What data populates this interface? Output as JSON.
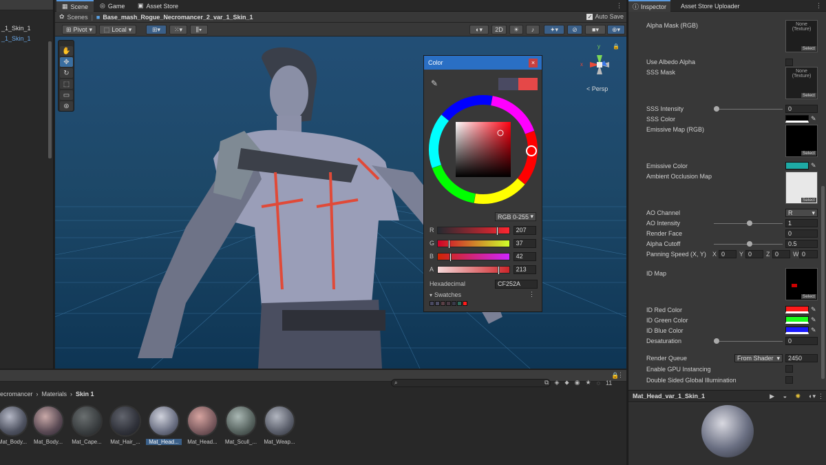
{
  "hierarchy": {
    "items": [
      "_1_Skin_1",
      "_1_Skin_1"
    ]
  },
  "tabs": {
    "scene": "Scene",
    "game": "Game",
    "store": "Asset Store"
  },
  "breadcrumb": {
    "scenes": "Scenes",
    "object": "Base_mash_Rogue_Necromancer_2_var_1_Skin_1",
    "autosave": "Auto Save"
  },
  "toolbar": {
    "pivot": "Pivot",
    "local": "Local",
    "twod": "2D",
    "persp": "< Persp"
  },
  "colorpicker": {
    "title": "Color",
    "mode": "RGB 0-255",
    "channels": [
      {
        "label": "R",
        "value": "207"
      },
      {
        "label": "G",
        "value": "37"
      },
      {
        "label": "B",
        "value": "42"
      },
      {
        "label": "A",
        "value": "213"
      }
    ],
    "hex_label": "Hexadecimal",
    "hex_value": "CF252A",
    "swatches_label": "Swatches",
    "current_color": "#CF252A"
  },
  "inspector": {
    "tab_inspector": "Inspector",
    "tab_uploader": "Asset Store Uploader",
    "alpha_mask": "Alpha Mask (RGB)",
    "none_texture": "None\n(Texture)",
    "select": "Select",
    "use_albedo_alpha": "Use Albedo Alpha",
    "sss_mask": "SSS Mask",
    "sss_intensity": "SSS Intensity",
    "sss_intensity_val": "0",
    "sss_color": "SSS Color",
    "emissive_map": "Emissive Map (RGB)",
    "emissive_color": "Emissive Color",
    "ao_map": "Ambient Occlusion Map",
    "ao_channel": "AO Channel",
    "ao_channel_val": "R",
    "ao_intensity": "AO Intensity",
    "ao_intensity_val": "1",
    "render_face": "Render Face",
    "render_face_val": "0",
    "alpha_cutoff": "Alpha Cutoff",
    "alpha_cutoff_val": "0.5",
    "panning": "Panning Speed (X, Y)",
    "pan_x": "X",
    "pan_x_val": "0",
    "pan_y": "Y",
    "pan_y_val": "0",
    "pan_z": "Z",
    "pan_z_val": "0",
    "pan_w": "W",
    "pan_w_val": "0",
    "id_map": "ID Map",
    "id_red": "ID Red Color",
    "id_green": "ID Green Color",
    "id_blue": "ID Blue Color",
    "desaturation": "Desaturation",
    "desaturation_val": "0",
    "render_queue": "Render Queue",
    "render_queue_mode": "From Shader",
    "render_queue_val": "2450",
    "gpu_instancing": "Enable GPU Instancing",
    "double_sided": "Double Sided Global Illumination",
    "material_name": "Mat_Head_var_1_Skin_1"
  },
  "project": {
    "crumb": [
      "ecromancer",
      "Materials",
      "Skin 1"
    ],
    "count": "11",
    "assets": [
      "Mat_Body...",
      "Mat_Body...",
      "Mat_Cape...",
      "Mat_Hair_...",
      "Mat_Head...",
      "Mat_Head...",
      "Mat_Scull_...",
      "Mat_Weap..."
    ]
  }
}
